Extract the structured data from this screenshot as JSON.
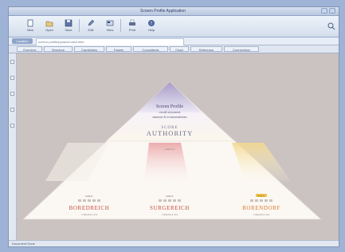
{
  "window": {
    "title": "Screen Profile Application"
  },
  "toolbar": {
    "buttons": [
      {
        "label": "New",
        "icon": "new-icon"
      },
      {
        "label": "Open",
        "icon": "open-icon"
      },
      {
        "label": "Save",
        "icon": "save-icon"
      },
      {
        "label": "Edit",
        "icon": "edit-icon"
      },
      {
        "label": "View",
        "icon": "view-icon"
      },
      {
        "label": "Print",
        "icon": "print-icon"
      },
      {
        "label": "Help",
        "icon": "help-icon"
      }
    ]
  },
  "address": {
    "label": "Location",
    "value": "screen-profile/pyramid-view.html"
  },
  "tabs": [
    "Overview",
    "Structure",
    "Candidates",
    "Panels",
    "Consultants",
    "Chart",
    "Reference",
    "Connections"
  ],
  "diagram": {
    "apex_title": "Screen Profile",
    "apex_sub1": "overall assessment",
    "apex_sub2": "summary & recommendations",
    "middle_small": "SCORE",
    "middle_big": "AUTHORITY",
    "middle_caption": "summary",
    "bases": [
      {
        "top": "ROLE",
        "word": "BOREDREICH",
        "caption": "competency area",
        "color": "#c44d3a"
      },
      {
        "top": "ROLE",
        "word": "SURGEREICH",
        "caption": "competency area",
        "color": "#c44d3a"
      },
      {
        "top": "ROLE",
        "word": "BORENDORF",
        "caption": "competency area",
        "color": "#d9792b"
      }
    ]
  },
  "status": {
    "text": "Document Done"
  }
}
